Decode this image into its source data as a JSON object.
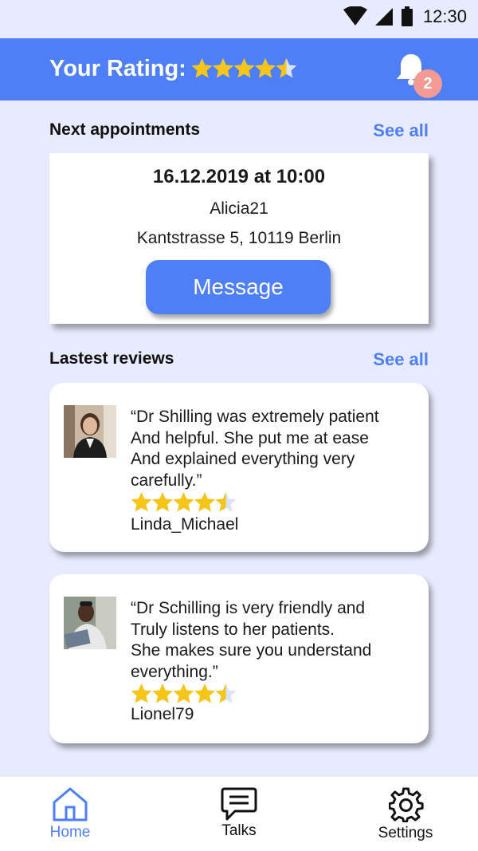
{
  "status_bar": {
    "time": "12:30",
    "icons": [
      "wifi-icon",
      "signal-icon",
      "battery-icon"
    ]
  },
  "header": {
    "title": "Your Rating:",
    "rating": 4.5,
    "notification_count": "2"
  },
  "appointments": {
    "section_title": "Next appointments",
    "see_all": "See all",
    "next": {
      "date_time": "16.12.2019 at 10:00",
      "user": "Alicia21",
      "address": "Kantstrasse 5, 10119 Berlin",
      "button_label": "Message"
    }
  },
  "reviews": {
    "section_title": "Lastest reviews",
    "see_all": "See all",
    "items": [
      {
        "quote": "“Dr Shilling was extremely patient\n And helpful. She put me at ease\nAnd explained everything very\ncarefully.”",
        "rating": 4.5,
        "author": "Linda_Michael"
      },
      {
        "quote": "“Dr Schilling is very friendly and\nTruly listens to her patients.\nShe makes sure you understand\neverything.”",
        "rating": 4.5,
        "author": "Lionel79"
      }
    ]
  },
  "bottom_nav": {
    "items": [
      {
        "label": "Home",
        "icon": "home-icon",
        "active": true
      },
      {
        "label": "Talks",
        "icon": "chat-icon",
        "active": false
      },
      {
        "label": "Settings",
        "icon": "gear-icon",
        "active": false
      }
    ]
  },
  "colors": {
    "accent": "#4f7ff7",
    "background": "#e8ebfd",
    "star": "#f5c518",
    "badge": "#f29a93"
  }
}
